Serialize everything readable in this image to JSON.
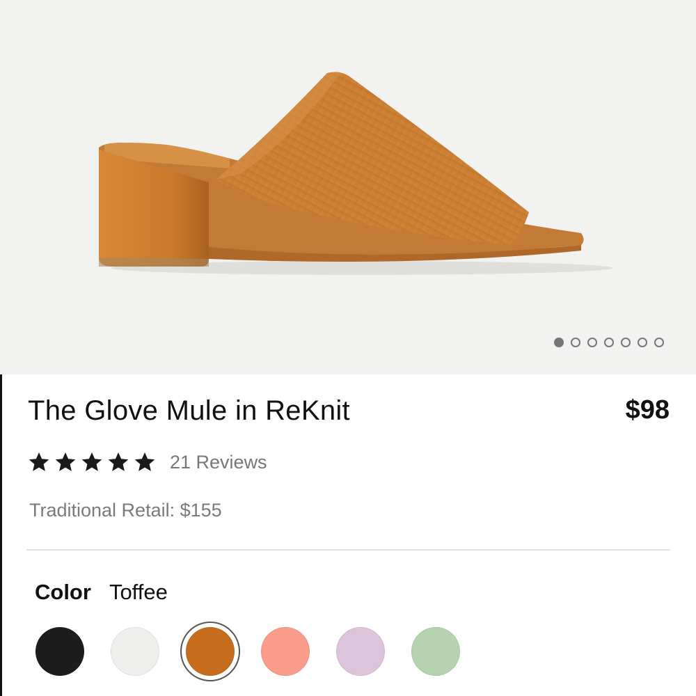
{
  "product": {
    "title": "The Glove Mule in ReKnit",
    "price": "$98",
    "reviews_text": "21 Reviews",
    "rating": 5,
    "traditional_retail": "Traditional Retail: $155"
  },
  "gallery": {
    "image_count": 7,
    "active_index": 0
  },
  "color": {
    "label": "Color",
    "selected": "Toffee",
    "swatches": [
      "#1d1d1d",
      "#eeeeec",
      "#c56d1c",
      "#f99d8a",
      "#dcc5da",
      "#b6d3b0"
    ],
    "selected_index": 2
  },
  "icons": {
    "star": "star-icon",
    "pagination_dot": "dot-icon"
  }
}
